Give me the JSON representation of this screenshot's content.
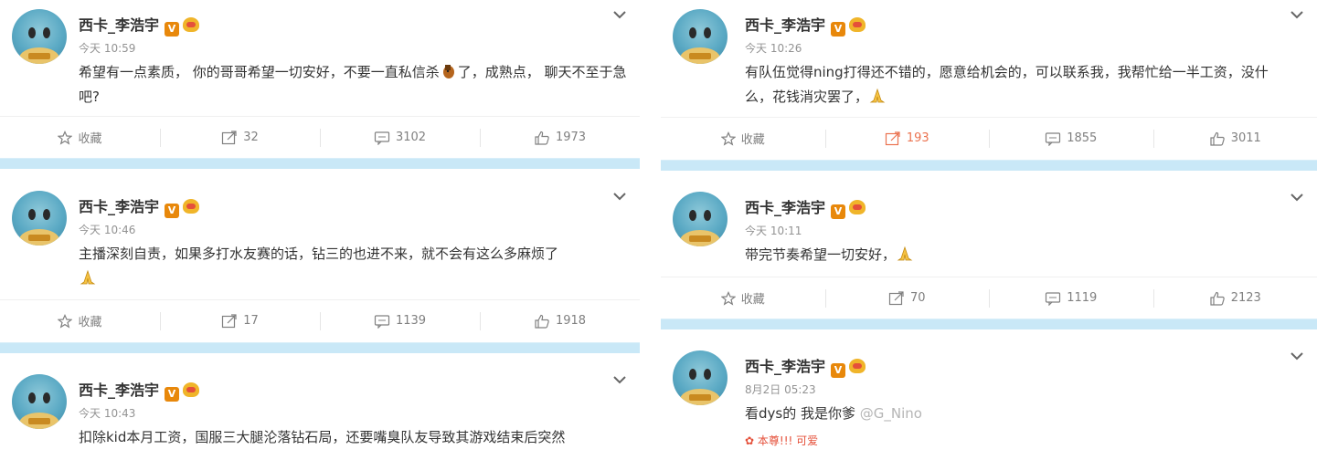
{
  "left_column": {
    "posts": [
      {
        "author": "西卡_李浩宇",
        "badge_v": "V",
        "time": "今天 10:59",
        "text_parts": [
          "希望有一点素质， 你的哥哥希望一切安好，不要一直私信杀",
          "了，成熟点， 聊天不至于急吧?"
        ],
        "emoji": "horse-emoji",
        "actions": {
          "favorite": "收藏",
          "repost": "32",
          "comment": "3102",
          "like": "1973"
        }
      },
      {
        "author": "西卡_李浩宇",
        "badge_v": "V",
        "time": "今天 10:46",
        "text": "主播深刻自责，如果多打水友赛的话，钻三的也进不来，就不会有这么多麻烦了",
        "emoji": "pray-emoji",
        "actions": {
          "favorite": "收藏",
          "repost": "17",
          "comment": "1139",
          "like": "1918"
        }
      },
      {
        "author": "西卡_李浩宇",
        "badge_v": "V",
        "time": "今天 10:43",
        "text": "扣除kid本月工资，国服三大腿沦落钻石局，还要嘴臭队友导致其游戏结束后突然"
      }
    ]
  },
  "right_column": {
    "posts": [
      {
        "author": "西卡_李浩宇",
        "badge_v": "V",
        "time": "今天 10:26",
        "text": "有队伍觉得ning打得还不错的，愿意给机会的，可以联系我，我帮忙给一半工资，没什么，花钱消灾罢了，",
        "emoji": "pray-emoji",
        "actions": {
          "favorite": "收藏",
          "repost": "193",
          "comment": "1855",
          "like": "3011"
        }
      },
      {
        "author": "西卡_李浩宇",
        "badge_v": "V",
        "time": "今天 10:11",
        "text": "带完节奏希望一切安好，",
        "emoji": "pray-emoji",
        "actions": {
          "favorite": "收藏",
          "repost": "70",
          "comment": "1119",
          "like": "2123"
        }
      },
      {
        "author": "西卡_李浩宇",
        "badge_v": "V",
        "time": "8月2日 05:23",
        "text": "看dys的 我是你爹",
        "watermark": "@G_Nino",
        "extra": "本尊!!! 可爱"
      }
    ]
  },
  "colors": {
    "separator": "#c9e8f7",
    "hot_repost": "#eb7350",
    "badge": "#e8880b",
    "muted": "#939393"
  }
}
